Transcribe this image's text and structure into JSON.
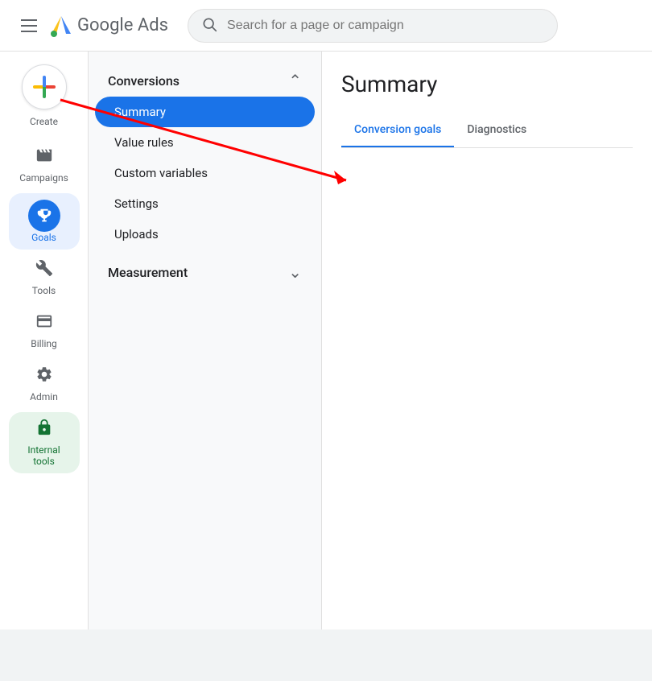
{
  "header": {
    "hamburger_label": "Menu",
    "logo_text": "Google Ads",
    "search_placeholder": "Search for a page or campaign"
  },
  "sidebar": {
    "create_label": "Create",
    "items": [
      {
        "id": "campaigns",
        "label": "Campaigns",
        "icon": "📢",
        "active": false
      },
      {
        "id": "goals",
        "label": "Goals",
        "icon": "🏆",
        "active": true
      },
      {
        "id": "tools",
        "label": "Tools",
        "icon": "🔧",
        "active": false
      },
      {
        "id": "billing",
        "label": "Billing",
        "icon": "💳",
        "active": false
      },
      {
        "id": "admin",
        "label": "Admin",
        "icon": "⚙️",
        "active": false
      },
      {
        "id": "internal-tools",
        "label": "Internal tools",
        "icon": "🔒",
        "active": false,
        "highlight": true
      }
    ]
  },
  "nav_panel": {
    "sections": [
      {
        "title": "Conversions",
        "expanded": true,
        "items": [
          {
            "label": "Summary",
            "active": true
          },
          {
            "label": "Value rules",
            "active": false
          },
          {
            "label": "Custom variables",
            "active": false
          },
          {
            "label": "Settings",
            "active": false
          },
          {
            "label": "Uploads",
            "active": false
          }
        ]
      },
      {
        "title": "Measurement",
        "expanded": false,
        "items": []
      }
    ]
  },
  "content": {
    "title": "Summary",
    "tabs": [
      {
        "label": "Conversion goals",
        "active": true
      },
      {
        "label": "Diagnostics",
        "active": false
      }
    ],
    "active_tab_label": "Conversion goals"
  }
}
